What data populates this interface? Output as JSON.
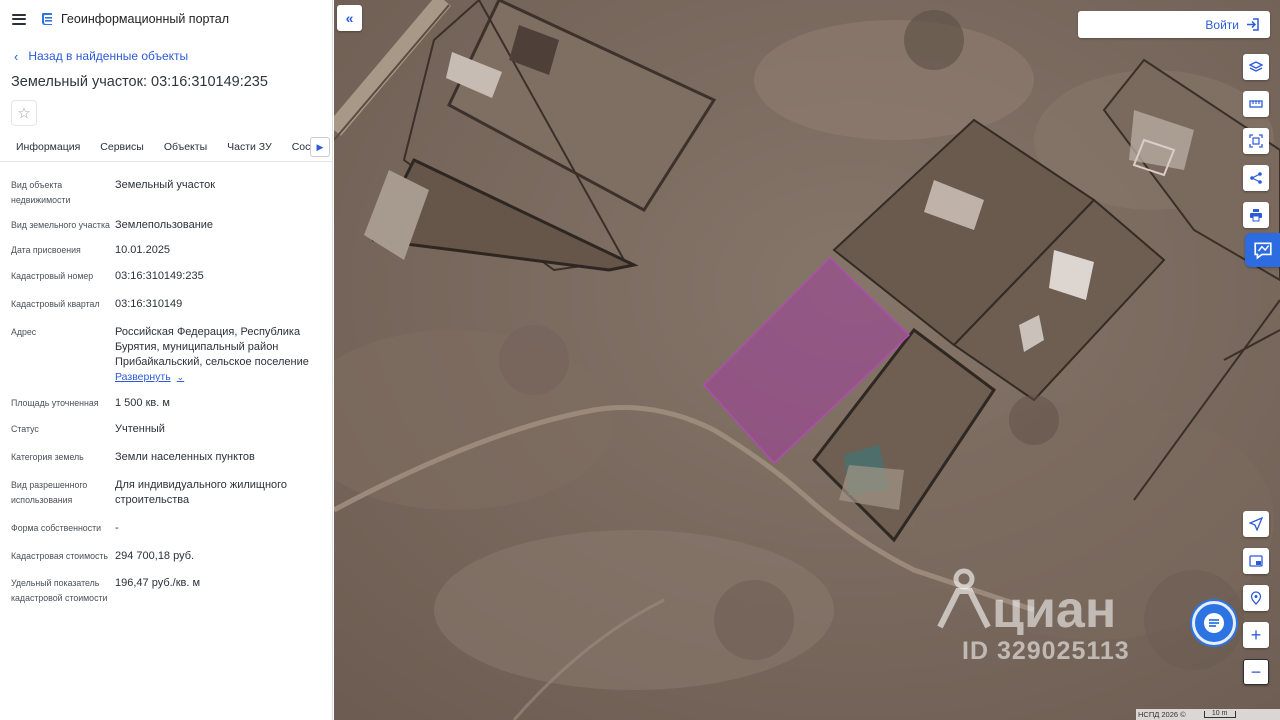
{
  "header": {
    "app_title": "Геоинформационный портал"
  },
  "nav": {
    "back_label": "Назад в найденные объекты"
  },
  "object": {
    "title": "Земельный участок: 03:16:310149:235"
  },
  "tabs": [
    {
      "label": "Информация",
      "active": true
    },
    {
      "label": "Сервисы"
    },
    {
      "label": "Объекты"
    },
    {
      "label": "Части ЗУ"
    },
    {
      "label": "Состав"
    }
  ],
  "props": {
    "type_label": "Вид объекта недвижимости",
    "type_value": "Земельный участок",
    "land_kind_label": "Вид земельного участка",
    "land_kind_value": "Землепользование",
    "date_label": "Дата присвоения",
    "date_value": "10.01.2025",
    "cad_num_label": "Кадастровый номер",
    "cad_num_value": "03:16:310149:235",
    "cad_quarter_label": "Кадастровый квартал",
    "cad_quarter_value": "03:16:310149",
    "address_label": "Адрес",
    "address_value": "Российская Федерация, Республика Бурятия, муниципальный район Прибайкальский, сельское поселение",
    "expand_label": "Развернуть",
    "area_label": "Площадь уточненная",
    "area_value": "1 500 кв. м",
    "status_label": "Статус",
    "status_value": "Учтенный",
    "category_label": "Категория земель",
    "category_value": "Земли населенных пунктов",
    "permitted_use_label": "Вид разрешенного использования",
    "permitted_use_value": "Для индивидуального жилищного строительства",
    "ownership_label": "Форма собственности",
    "ownership_value": "-",
    "cad_cost_label": "Кадастровая стоимость",
    "cad_cost_value": "294 700,18 руб.",
    "unit_cost_label": "Удельный показатель кадастровой стоимости",
    "unit_cost_value": "196,47 руб./кв. м"
  },
  "map": {
    "login_label": "Войти",
    "watermark_id": "ID 329025113",
    "attribution": "НСПД 2026 ©",
    "scale_label": "10 m",
    "plot_color": "#a0409c"
  }
}
